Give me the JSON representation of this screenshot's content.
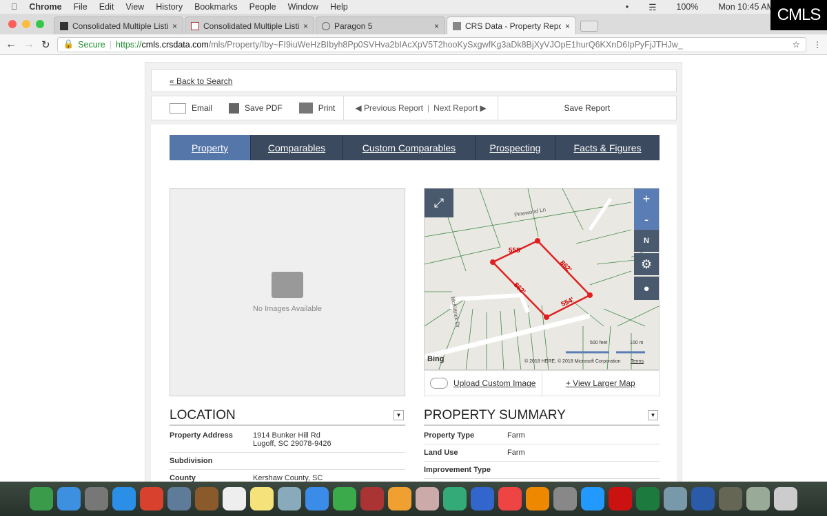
{
  "menubar": {
    "items": [
      "Chrome",
      "File",
      "Edit",
      "View",
      "History",
      "Bookmarks",
      "People",
      "Window",
      "Help"
    ],
    "battery": "100%",
    "clock": "Mon 10:45 AM"
  },
  "logo": "CMLS",
  "tabs": [
    {
      "title": "Consolidated Multiple Listing S"
    },
    {
      "title": "Consolidated Multiple Listing"
    },
    {
      "title": "Paragon 5"
    },
    {
      "title": "CRS Data - Property Report fo"
    }
  ],
  "address": {
    "secure": "Secure",
    "scheme": "https://",
    "domain": "cmls.crsdata.com",
    "path": "/mls/Property/Iby~FI9iuWeHzBIbyh8Pp0SVHva2bIAcXpV5T2hooKySxgwfKg3aDk8BjXyVJOpE1hurQ6KXnD6IpPyFjJTHJw_"
  },
  "back": "« Back to Search",
  "toolbar": {
    "email": "Email",
    "save_pdf": "Save PDF",
    "print": "Print",
    "prev": "Previous Report",
    "next": "Next Report",
    "save_report": "Save Report"
  },
  "nav": [
    "Property",
    "Comparables",
    "Custom Comparables",
    "Prospecting",
    "Facts & Figures"
  ],
  "no_images": "No Images Available",
  "map": {
    "labels": [
      "558'",
      "862'",
      "862'",
      "554'"
    ],
    "streets": [
      "Pinewood Ln",
      "McKittrick Dr"
    ],
    "scale_ft": "500 feet",
    "scale_m": "100 m",
    "bing": "Bing",
    "copyright": "© 2018 HERE, © 2018 Microsoft Corporation",
    "terms": "Terms",
    "compass": "N"
  },
  "map_footer": {
    "upload": "Upload Custom Image",
    "larger": "+ View Larger Map"
  },
  "location": {
    "title": "LOCATION",
    "rows": [
      {
        "k": "Property Address",
        "v": "1914 Bunker Hill Rd",
        "v2": "Lugoff, SC 29078-9426"
      },
      {
        "k": "Subdivision",
        "v": ""
      },
      {
        "k": "County",
        "v": "Kershaw County, SC"
      }
    ]
  },
  "summary": {
    "title": "PROPERTY SUMMARY",
    "rows": [
      {
        "k": "Property Type",
        "v": "Farm"
      },
      {
        "k": "Land Use",
        "v": "Farm"
      },
      {
        "k": "Improvement Type",
        "v": ""
      }
    ]
  }
}
